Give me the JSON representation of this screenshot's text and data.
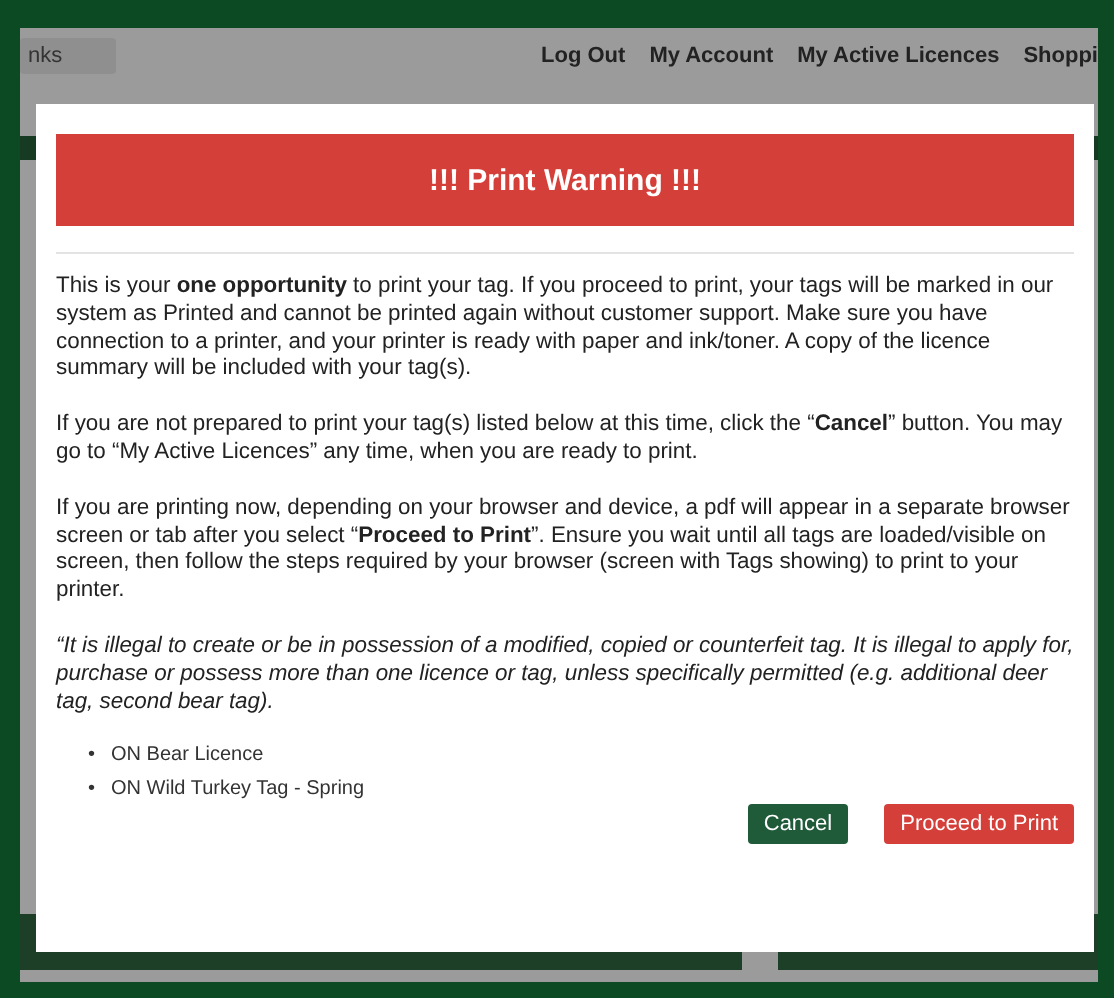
{
  "header": {
    "search_value": "nks",
    "nav": [
      "Log Out",
      "My Account",
      "My Active Licences",
      "Shoppi"
    ]
  },
  "modal": {
    "title": "!!! Print Warning !!!",
    "paragraphs": [
      {
        "kind": "normal",
        "text": "This is your **one opportunity** to print your tag. If you proceed to print, your tags will be marked in our system as Printed and cannot be printed again without customer support. Make sure you have connection to a printer, and your printer is ready with paper and ink/toner.  A copy of the licence summary will be included with your tag(s)."
      },
      {
        "kind": "normal",
        "text": "If you are not prepared to print your tag(s) listed below at this time, click the “**Cancel**” button. You may go to “My Active Licences” any time, when you are ready to print."
      },
      {
        "kind": "normal",
        "text": "If you are printing now, depending on your browser and device, a pdf will appear in a separate browser screen or tab after you select “**Proceed to Print**”.  Ensure you wait until all tags are loaded/visible on screen, then follow the steps required by your browser (screen with Tags showing) to print to your printer."
      },
      {
        "kind": "italic",
        "text": "“It is illegal to create or be in possession of a modified, copied or counterfeit tag. It is illegal to apply for, purchase or possess more than one licence or tag, unless specifically permitted (e.g. additional deer tag, second bear tag)."
      }
    ],
    "items": [
      {
        "marker": "•",
        "text": "ON Bear Licence"
      },
      {
        "marker": "•",
        "text": "ON Wild Turkey Tag - Spring"
      }
    ],
    "buttons": [
      {
        "kind": "secondary",
        "label": "Cancel"
      },
      {
        "kind": "primary",
        "label": "Proceed to Print"
      }
    ]
  }
}
